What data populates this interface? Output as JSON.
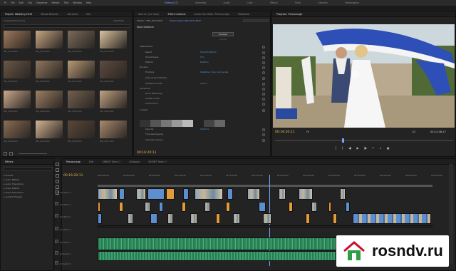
{
  "menubar": {
    "items": [
      "Pr",
      "File",
      "Edit",
      "Clip",
      "Sequence",
      "Marker",
      "Title",
      "Window",
      "Help"
    ]
  },
  "workspaces": [
    "Editing (CC)",
    "Assembly",
    "Audio",
    "Color",
    "Effects",
    "Titles",
    "Libraries",
    "Metalogging"
  ],
  "project_panel": {
    "tabs": [
      "Project: Wedding 2015",
      "Media Browser",
      "Libraries",
      "Info"
    ],
    "path": "Snippets-Film.prproj",
    "count": "198 Items",
    "thumbs": [
      {
        "label": "IMG_0012.MOV"
      },
      {
        "label": "IMG_0015.MOV"
      },
      {
        "label": "IMG_0016.MOV"
      },
      {
        "label": "IMG_0021.MOV"
      },
      {
        "label": "IMG_0025.MOV"
      },
      {
        "label": "IMG_0028.MOV"
      },
      {
        "label": "IMG_0031.MOV"
      },
      {
        "label": "IMG_0035.MOV"
      },
      {
        "label": "IMG_0038.MOV"
      },
      {
        "label": "IMG_0040.MOV"
      },
      {
        "label": "IMG_0042.MOV"
      },
      {
        "label": "IMG_0045.MOV"
      },
      {
        "label": "IMG_0049.MOV"
      },
      {
        "label": "IMG_0052.MOV"
      },
      {
        "label": "IMG_0054.MOV"
      },
      {
        "label": "IMG_0057.MOV"
      }
    ]
  },
  "effects_panel": {
    "tabs": [
      "Source: (no clips)",
      "Effect Controls",
      "Audio Clip Mixer: Personnage",
      "Metadata"
    ],
    "source": "Master * IMG_0012.MOV",
    "sequence": "Personnage * IMG_0012.MOV",
    "section": "Warp Stabilizer",
    "analyze": "Analyze",
    "cancel": "Cancel",
    "rows": [
      {
        "label": "Stabilization",
        "value": ""
      },
      {
        "label": "Result",
        "value": "Smooth Motion"
      },
      {
        "label": "Smoothness",
        "value": "5 %"
      },
      {
        "label": "Method",
        "value": "Position"
      },
      {
        "label": "Borders",
        "value": ""
      },
      {
        "label": "Framing",
        "value": "Stabilize, Crop, Auto-scale"
      },
      {
        "label": "Auto-scale (100.0%)",
        "value": ""
      },
      {
        "label": "Additional Scale",
        "value": "100 %"
      },
      {
        "label": "Advanced",
        "value": ""
      },
      {
        "label": "Track Matte Key",
        "value": ""
      },
      {
        "label": "Lumetri Color",
        "value": ""
      },
      {
        "label": "Invert Track",
        "value": ""
      },
      {
        "label": "Lumetri",
        "value": ""
      },
      {
        "label": "Opacity",
        "value": "100.0 %"
      },
      {
        "label": "Time Remapping",
        "value": ""
      },
      {
        "label": "Channel Volume",
        "value": ""
      }
    ],
    "timecode": "00:16:20:11"
  },
  "program_monitor": {
    "tab": "Program: Personnage",
    "timecode": "00:16:20:11",
    "fit": "Fit",
    "quality": "1/2",
    "duration": "00:12:46:17"
  },
  "effects_browser": {
    "tab": "Effects",
    "items": [
      "Presets",
      "Audio Effects",
      "Audio Transitions",
      "Video Effects",
      "Video Transitions",
      "Lumetri Presets"
    ]
  },
  "timeline": {
    "tabs": [
      "Personnage",
      "Edit",
      "SKRINT Team 1",
      "Dialogue",
      "SKRINT Team 2"
    ],
    "timecode": "00:16:20:11",
    "ruler": [
      "00:00:00:00",
      "00:04:00:00",
      "00:08:00:00",
      "00:12:00:00",
      "00:16:00:00",
      "00:20:00:00",
      "00:24:00:00",
      "00:28:00:00",
      "00:32:00:00",
      "00:36:00:00",
      "00:40:00:00",
      "00:44:00:00",
      "00:48:00:00",
      "00:52:00:00"
    ],
    "tracks": [
      "V4",
      "V3",
      "V2",
      "V1",
      "A1",
      "A2",
      "A3"
    ],
    "track_names": [
      "Video 4",
      "Video 3",
      "Video 2",
      "Video 1",
      "Audio 1",
      "Audio 2",
      "Audio 3"
    ]
  },
  "watermark": {
    "text": "rosndv.ru"
  },
  "colors": {
    "accent": "#6fa8ff",
    "timecode": "#e8b84a",
    "clip_blue": "#5d8fcf",
    "clip_orange": "#e39a3a",
    "audio_green": "#3d9e6e",
    "badge_red": "#c8102e",
    "badge_green": "#2e9d44"
  }
}
